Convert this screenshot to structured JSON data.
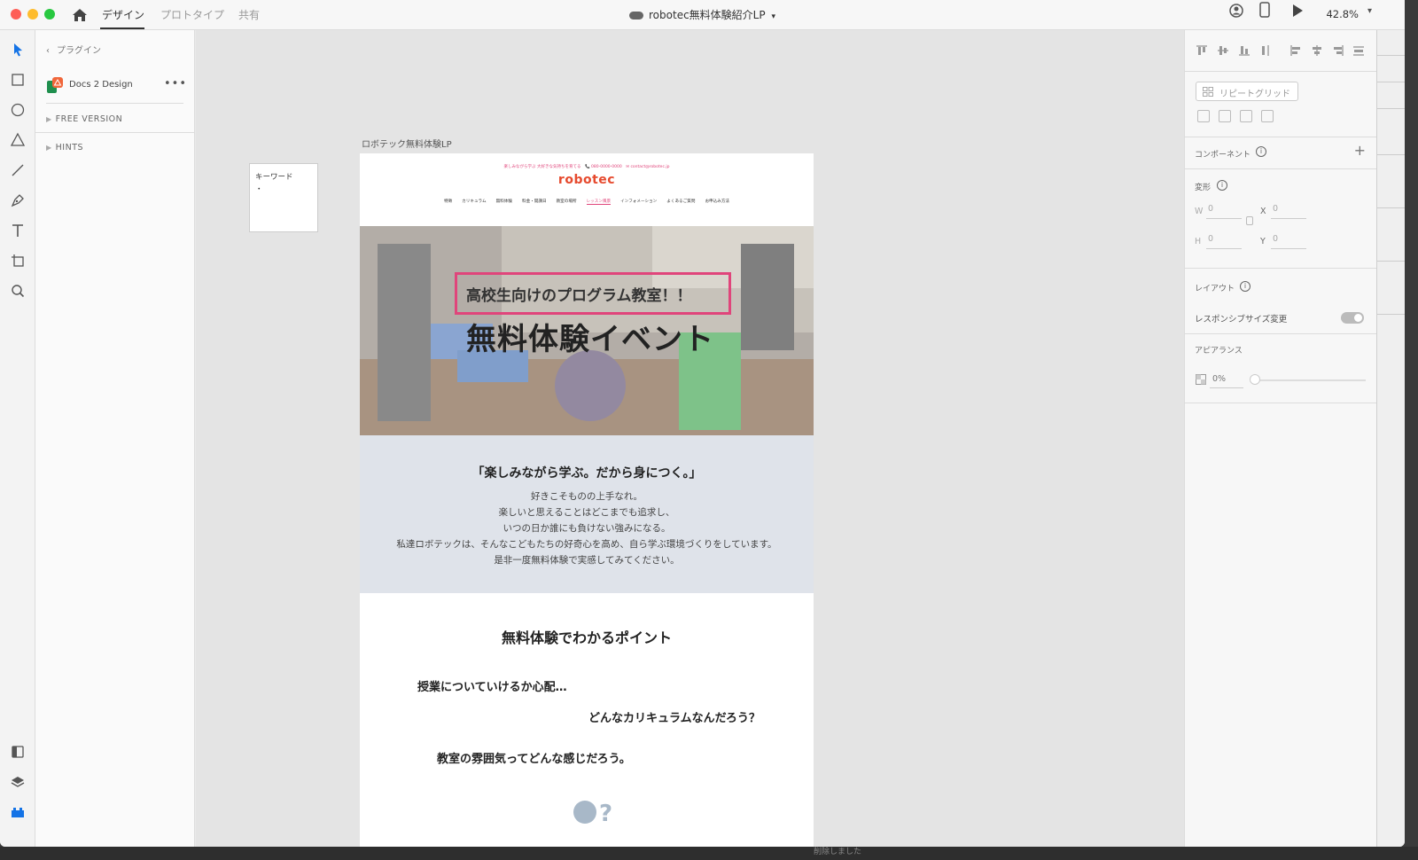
{
  "titlebar": {
    "tabs": [
      "デザイン",
      "プロトタイプ",
      "共有"
    ],
    "doc_title": "robotec無料体験紹介LP",
    "zoom": "42.8%"
  },
  "plugins_panel": {
    "back_label": "プラグイン",
    "plugin_name": "Docs 2 Design",
    "sections": [
      "FREE VERSION",
      "HINTS"
    ]
  },
  "canvas": {
    "keyword_card": {
      "title": "キーワード",
      "bullet": "・"
    },
    "artboard_label": "ロボテック無料体験LP",
    "lp": {
      "contact": "楽しみながら学ぶ 大好きな気持ちを育てる　📞 080-0000-0000　✉ contact@robotec.jp",
      "logo": "robotec",
      "nav": [
        "特徴",
        "カリキュラム",
        "無料体験",
        "料金・開講日",
        "教室の場所",
        "レッスン風景",
        "インフォメーション",
        "よくあるご質問",
        "お申込み方法"
      ],
      "nav_active": "レッスン風景",
      "hero_sub": "高校生向けのプログラム教室！！",
      "hero_title": "無料体験イベント",
      "about_title": "「楽しみながら学ぶ。だから身につく。」",
      "about_lines": [
        "好きこそものの上手なれ。",
        "楽しいと思えることはどこまでも追求し、",
        "いつの日か誰にも負けない強みになる。",
        "私達ロボテックは、そんなこどもたちの好奇心を高め、自ら学ぶ環境づくりをしています。",
        "是非一度無料体験で実感してみてください。"
      ],
      "points_title": "無料体験でわかるポイント",
      "questions": [
        "授業についていけるか心配…",
        "どんなカリキュラムなんだろう？",
        "教室の雰囲気ってどんな感じだろう。"
      ]
    }
  },
  "inspector": {
    "repeat_grid": "リピートグリッド",
    "component": "コンポーネント",
    "transform": "変形",
    "w_label": "W",
    "w_value": "0",
    "x_label": "X",
    "x_value": "0",
    "h_label": "H",
    "h_value": "0",
    "y_label": "Y",
    "y_value": "0",
    "layout": "レイアウト",
    "responsive": "レスポンシブサイズ変更",
    "appearance": "アピアランス",
    "opacity": "0%"
  },
  "bottom_bar": {
    "text": "削除しました"
  },
  "colors": {
    "accent": "#e0457b",
    "logo": "#e64a2e",
    "about_bg": "#dfe3ea"
  }
}
